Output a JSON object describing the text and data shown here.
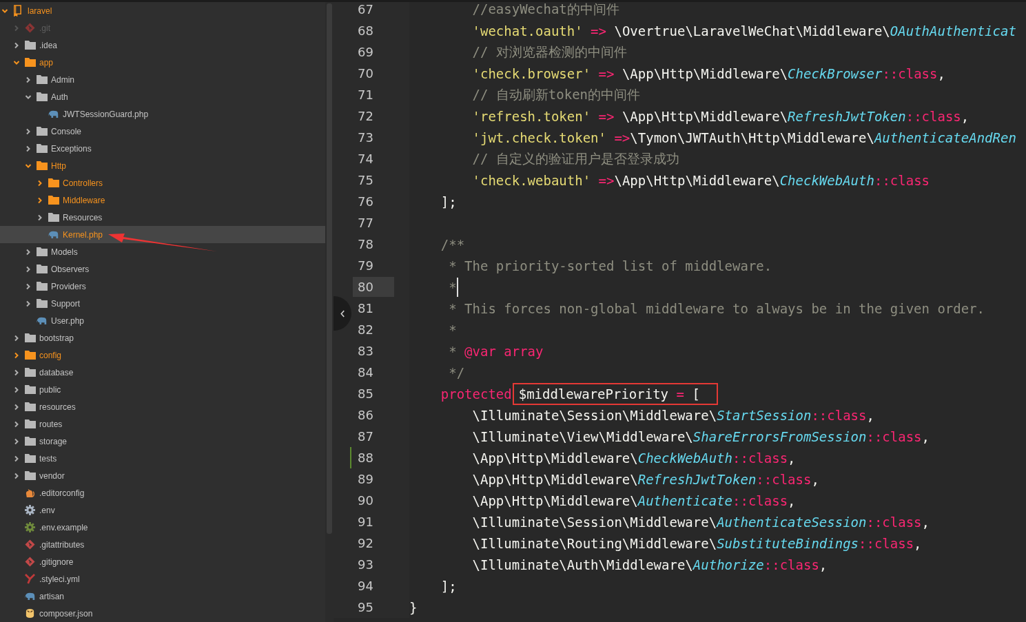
{
  "sidebar": {
    "pointer_arrow": true,
    "tree": [
      {
        "name": "laravel",
        "kind": "project",
        "modified": true,
        "ignored": false,
        "expanded": true,
        "selected": false,
        "children": [
          {
            "name": ".git",
            "kind": "git",
            "modified": false,
            "ignored": true,
            "expanded": false,
            "selected": false
          },
          {
            "name": ".idea",
            "kind": "folder",
            "modified": false,
            "ignored": false,
            "expanded": false,
            "selected": false
          },
          {
            "name": "app",
            "kind": "folder",
            "modified": true,
            "ignored": false,
            "expanded": true,
            "selected": false,
            "children": [
              {
                "name": "Admin",
                "kind": "folder",
                "modified": false,
                "ignored": false,
                "expanded": false,
                "selected": false
              },
              {
                "name": "Auth",
                "kind": "folder",
                "modified": false,
                "ignored": false,
                "expanded": true,
                "selected": false,
                "children": [
                  {
                    "name": "JWTSessionGuard.php",
                    "kind": "php",
                    "modified": false,
                    "ignored": false,
                    "selected": false
                  }
                ]
              },
              {
                "name": "Console",
                "kind": "folder",
                "modified": false,
                "ignored": false,
                "expanded": false,
                "selected": false
              },
              {
                "name": "Exceptions",
                "kind": "folder",
                "modified": false,
                "ignored": false,
                "expanded": false,
                "selected": false
              },
              {
                "name": "Http",
                "kind": "folder",
                "modified": true,
                "ignored": false,
                "expanded": true,
                "selected": false,
                "children": [
                  {
                    "name": "Controllers",
                    "kind": "folder",
                    "modified": true,
                    "ignored": false,
                    "expanded": false,
                    "selected": false
                  },
                  {
                    "name": "Middleware",
                    "kind": "folder",
                    "modified": true,
                    "ignored": false,
                    "expanded": false,
                    "selected": false
                  },
                  {
                    "name": "Resources",
                    "kind": "folder",
                    "modified": false,
                    "ignored": false,
                    "expanded": false,
                    "selected": false
                  },
                  {
                    "name": "Kernel.php",
                    "kind": "php",
                    "modified": true,
                    "ignored": false,
                    "selected": true
                  }
                ]
              },
              {
                "name": "Models",
                "kind": "folder",
                "modified": false,
                "ignored": false,
                "expanded": false,
                "selected": false
              },
              {
                "name": "Observers",
                "kind": "folder",
                "modified": false,
                "ignored": false,
                "expanded": false,
                "selected": false
              },
              {
                "name": "Providers",
                "kind": "folder",
                "modified": false,
                "ignored": false,
                "expanded": false,
                "selected": false
              },
              {
                "name": "Support",
                "kind": "folder",
                "modified": false,
                "ignored": false,
                "expanded": false,
                "selected": false
              },
              {
                "name": "User.php",
                "kind": "php",
                "modified": false,
                "ignored": false,
                "selected": false
              }
            ]
          },
          {
            "name": "bootstrap",
            "kind": "folder",
            "modified": false,
            "ignored": false,
            "expanded": false,
            "selected": false
          },
          {
            "name": "config",
            "kind": "folder",
            "modified": true,
            "ignored": false,
            "expanded": false,
            "selected": false
          },
          {
            "name": "database",
            "kind": "folder",
            "modified": false,
            "ignored": false,
            "expanded": false,
            "selected": false
          },
          {
            "name": "public",
            "kind": "folder",
            "modified": false,
            "ignored": false,
            "expanded": false,
            "selected": false
          },
          {
            "name": "resources",
            "kind": "folder",
            "modified": false,
            "ignored": false,
            "expanded": false,
            "selected": false
          },
          {
            "name": "routes",
            "kind": "folder",
            "modified": false,
            "ignored": false,
            "expanded": false,
            "selected": false
          },
          {
            "name": "storage",
            "kind": "folder",
            "modified": false,
            "ignored": false,
            "expanded": false,
            "selected": false
          },
          {
            "name": "tests",
            "kind": "folder",
            "modified": false,
            "ignored": false,
            "expanded": false,
            "selected": false
          },
          {
            "name": "vendor",
            "kind": "folder",
            "modified": false,
            "ignored": false,
            "expanded": false,
            "selected": false
          },
          {
            "name": ".editorconfig",
            "kind": "editorconfig",
            "modified": false,
            "ignored": false,
            "selected": false
          },
          {
            "name": ".env",
            "kind": "env",
            "modified": false,
            "ignored": false,
            "selected": false
          },
          {
            "name": ".env.example",
            "kind": "env-example",
            "modified": false,
            "ignored": false,
            "selected": false
          },
          {
            "name": ".gitattributes",
            "kind": "git",
            "modified": false,
            "ignored": false,
            "selected": false
          },
          {
            "name": ".gitignore",
            "kind": "git",
            "modified": false,
            "ignored": false,
            "selected": false
          },
          {
            "name": ".styleci.yml",
            "kind": "yaml",
            "modified": false,
            "ignored": false,
            "selected": false
          },
          {
            "name": "artisan",
            "kind": "php",
            "modified": false,
            "ignored": false,
            "selected": false
          },
          {
            "name": "composer.json",
            "kind": "composer",
            "modified": false,
            "ignored": false,
            "selected": false
          }
        ]
      }
    ]
  },
  "editor": {
    "lines": [
      {
        "number": "67",
        "current": false,
        "changed": false,
        "tokens": [
          {
            "kind": "comment",
            "text": "        //easyWechat的中间件"
          }
        ]
      },
      {
        "number": "68",
        "current": false,
        "changed": false,
        "tokens": [
          {
            "kind": "string",
            "text": "        'wechat.oauth'"
          },
          {
            "kind": "op",
            "text": " => "
          },
          {
            "kind": "plain",
            "text": "\\Overtrue\\LaravelWeChat\\Middleware\\"
          },
          {
            "kind": "class",
            "text": "OAuthAuthenticat"
          }
        ]
      },
      {
        "number": "69",
        "current": false,
        "changed": false,
        "tokens": [
          {
            "kind": "comment",
            "text": "        // 对浏览器检测的中间件"
          }
        ]
      },
      {
        "number": "70",
        "current": false,
        "changed": false,
        "tokens": [
          {
            "kind": "string",
            "text": "        'check.browser'"
          },
          {
            "kind": "op",
            "text": " => "
          },
          {
            "kind": "plain",
            "text": "\\App\\Http\\Middleware\\"
          },
          {
            "kind": "class",
            "text": "CheckBrowser"
          },
          {
            "kind": "op",
            "text": "::class"
          },
          {
            "kind": "plain",
            "text": ","
          }
        ]
      },
      {
        "number": "71",
        "current": false,
        "changed": false,
        "tokens": [
          {
            "kind": "comment",
            "text": "        // 自动刷新token的中间件"
          }
        ]
      },
      {
        "number": "72",
        "current": false,
        "changed": false,
        "tokens": [
          {
            "kind": "string",
            "text": "        'refresh.token'"
          },
          {
            "kind": "op",
            "text": " => "
          },
          {
            "kind": "plain",
            "text": "\\App\\Http\\Middleware\\"
          },
          {
            "kind": "class",
            "text": "RefreshJwtToken"
          },
          {
            "kind": "op",
            "text": "::class"
          },
          {
            "kind": "plain",
            "text": ","
          }
        ]
      },
      {
        "number": "73",
        "current": false,
        "changed": false,
        "tokens": [
          {
            "kind": "string",
            "text": "        'jwt.check.token'"
          },
          {
            "kind": "op",
            "text": " =>"
          },
          {
            "kind": "plain",
            "text": "\\Tymon\\JWTAuth\\Http\\Middleware\\"
          },
          {
            "kind": "class",
            "text": "AuthenticateAndRen"
          }
        ]
      },
      {
        "number": "74",
        "current": false,
        "changed": false,
        "tokens": [
          {
            "kind": "comment",
            "text": "        // 自定义的验证用户是否登录成功"
          }
        ]
      },
      {
        "number": "75",
        "current": false,
        "changed": false,
        "tokens": [
          {
            "kind": "string",
            "text": "        'check.webauth'"
          },
          {
            "kind": "op",
            "text": " =>"
          },
          {
            "kind": "plain",
            "text": "\\App\\Http\\Middleware\\"
          },
          {
            "kind": "class",
            "text": "CheckWebAuth"
          },
          {
            "kind": "op",
            "text": "::class"
          }
        ]
      },
      {
        "number": "76",
        "current": false,
        "changed": false,
        "tokens": [
          {
            "kind": "plain",
            "text": "    ];"
          }
        ]
      },
      {
        "number": "77",
        "current": false,
        "changed": false
      },
      {
        "number": "78",
        "current": false,
        "changed": false,
        "tokens": [
          {
            "kind": "doc",
            "text": "    /**"
          }
        ]
      },
      {
        "number": "79",
        "current": false,
        "changed": false,
        "tokens": [
          {
            "kind": "doc",
            "text": "     * The priority-sorted list of middleware."
          }
        ]
      },
      {
        "number": "80",
        "current": true,
        "changed": false,
        "tokens": [
          {
            "kind": "doc",
            "text": "     *"
          }
        ]
      },
      {
        "number": "81",
        "current": false,
        "changed": false,
        "tokens": [
          {
            "kind": "doc",
            "text": "     * This forces non-global middleware to always be in the given order."
          }
        ]
      },
      {
        "number": "82",
        "current": false,
        "changed": false,
        "tokens": [
          {
            "kind": "doc",
            "text": "     *"
          }
        ]
      },
      {
        "number": "83",
        "current": false,
        "changed": false,
        "tokens": [
          {
            "kind": "doc",
            "text": "     * "
          },
          {
            "kind": "doctag",
            "text": "@var array"
          }
        ]
      },
      {
        "number": "84",
        "current": false,
        "changed": false,
        "tokens": [
          {
            "kind": "doc",
            "text": "     */"
          }
        ]
      },
      {
        "number": "85",
        "current": false,
        "changed": false,
        "tokens": [
          {
            "kind": "keyword",
            "text": "    protected"
          }
        ],
        "boxed_tokens": [
          {
            "kind": "plain",
            "text": "$middlewarePriority "
          },
          {
            "kind": "op",
            "text": "="
          },
          {
            "kind": "plain",
            "text": " ["
          }
        ]
      },
      {
        "number": "86",
        "current": false,
        "changed": false,
        "tokens": [
          {
            "kind": "plain",
            "text": "        \\Illuminate\\Session\\Middleware\\"
          },
          {
            "kind": "class",
            "text": "StartSession"
          },
          {
            "kind": "op",
            "text": "::class"
          },
          {
            "kind": "plain",
            "text": ","
          }
        ]
      },
      {
        "number": "87",
        "current": false,
        "changed": false,
        "tokens": [
          {
            "kind": "plain",
            "text": "        \\Illuminate\\View\\Middleware\\"
          },
          {
            "kind": "class",
            "text": "ShareErrorsFromSession"
          },
          {
            "kind": "op",
            "text": "::class"
          },
          {
            "kind": "plain",
            "text": ","
          }
        ]
      },
      {
        "number": "88",
        "current": false,
        "changed": true,
        "tokens": [
          {
            "kind": "plain",
            "text": "        \\App\\Http\\Middleware\\"
          },
          {
            "kind": "class",
            "text": "CheckWebAuth"
          },
          {
            "kind": "op",
            "text": "::class"
          },
          {
            "kind": "plain",
            "text": ","
          }
        ]
      },
      {
        "number": "89",
        "current": false,
        "changed": false,
        "tokens": [
          {
            "kind": "plain",
            "text": "        \\App\\Http\\Middleware\\"
          },
          {
            "kind": "class",
            "text": "RefreshJwtToken"
          },
          {
            "kind": "op",
            "text": "::class"
          },
          {
            "kind": "plain",
            "text": ","
          }
        ]
      },
      {
        "number": "90",
        "current": false,
        "changed": false,
        "tokens": [
          {
            "kind": "plain",
            "text": "        \\App\\Http\\Middleware\\"
          },
          {
            "kind": "class",
            "text": "Authenticate"
          },
          {
            "kind": "op",
            "text": "::class"
          },
          {
            "kind": "plain",
            "text": ","
          }
        ]
      },
      {
        "number": "91",
        "current": false,
        "changed": false,
        "tokens": [
          {
            "kind": "plain",
            "text": "        \\Illuminate\\Session\\Middleware\\"
          },
          {
            "kind": "class",
            "text": "AuthenticateSession"
          },
          {
            "kind": "op",
            "text": "::class"
          },
          {
            "kind": "plain",
            "text": ","
          }
        ]
      },
      {
        "number": "92",
        "current": false,
        "changed": false,
        "tokens": [
          {
            "kind": "plain",
            "text": "        \\Illuminate\\Routing\\Middleware\\"
          },
          {
            "kind": "class",
            "text": "SubstituteBindings"
          },
          {
            "kind": "op",
            "text": "::class"
          },
          {
            "kind": "plain",
            "text": ","
          }
        ]
      },
      {
        "number": "93",
        "current": false,
        "changed": false,
        "tokens": [
          {
            "kind": "plain",
            "text": "        \\Illuminate\\Auth\\Middleware\\"
          },
          {
            "kind": "class",
            "text": "Authorize"
          },
          {
            "kind": "op",
            "text": "::class"
          },
          {
            "kind": "plain",
            "text": ","
          }
        ]
      },
      {
        "number": "94",
        "current": false,
        "changed": false,
        "tokens": [
          {
            "kind": "plain",
            "text": "    ];"
          }
        ]
      },
      {
        "number": "95",
        "current": false,
        "changed": false,
        "tokens": [
          {
            "kind": "plain",
            "text": "}"
          }
        ]
      }
    ]
  }
}
